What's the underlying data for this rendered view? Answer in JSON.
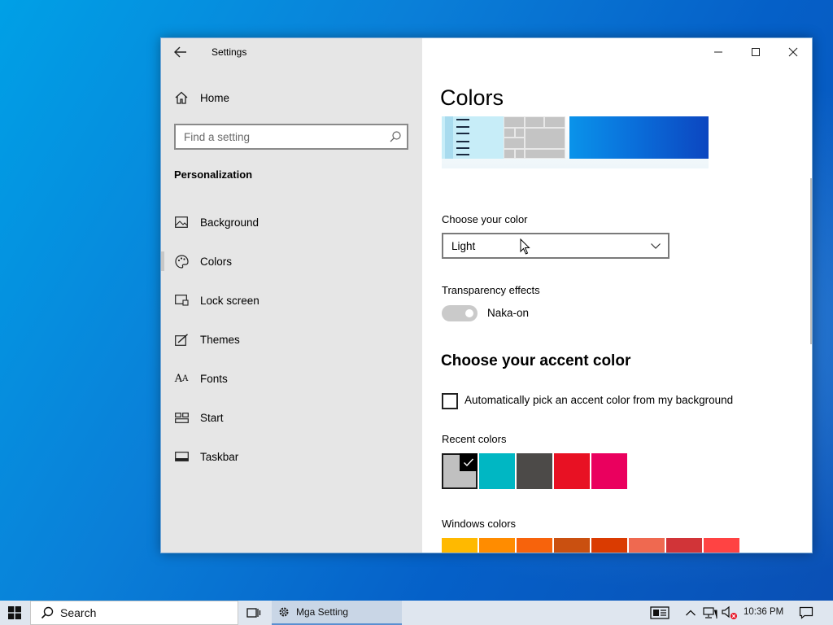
{
  "window": {
    "app_title": "Settings",
    "controls": {
      "minimize_icon": "minimize-icon",
      "maximize_icon": "maximize-icon",
      "close_icon": "close-icon"
    }
  },
  "sidebar": {
    "home_label": "Home",
    "search_placeholder": "Find a setting",
    "section_title": "Personalization",
    "items": [
      {
        "label": "Background",
        "icon": "image-icon"
      },
      {
        "label": "Colors",
        "icon": "palette-icon",
        "active": true
      },
      {
        "label": "Lock screen",
        "icon": "lock-screen-icon"
      },
      {
        "label": "Themes",
        "icon": "themes-icon"
      },
      {
        "label": "Fonts",
        "icon": "fonts-icon"
      },
      {
        "label": "Start",
        "icon": "start-icon"
      },
      {
        "label": "Taskbar",
        "icon": "taskbar-icon"
      }
    ]
  },
  "main": {
    "title": "Colors",
    "choose_color_label": "Choose your color",
    "choose_color_value": "Light",
    "transparency_label": "Transparency effects",
    "transparency_state": "Naka-on",
    "accent_heading": "Choose your accent color",
    "auto_accent_label": "Automatically pick an accent color from my background",
    "recent_colors_label": "Recent colors",
    "recent_colors": [
      "#c0c0c0",
      "#00b7c3",
      "#4c4a48",
      "#e81123",
      "#ea005e"
    ],
    "windows_colors_label": "Windows colors",
    "windows_colors": [
      "#ffb900",
      "#ff8c00",
      "#f7630c",
      "#ca5010",
      "#da3b01",
      "#ef6950",
      "#d13438",
      "#ff4343"
    ]
  },
  "taskbar": {
    "search_label": "Search",
    "app_label": "Mga Setting",
    "clock": "10:36 PM"
  }
}
